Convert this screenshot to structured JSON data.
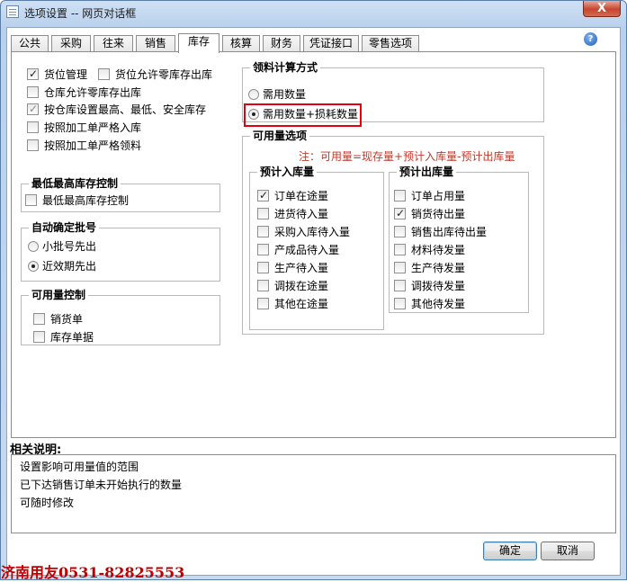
{
  "window": {
    "title": "选项设置 -- 网页对话框",
    "close_label": "X"
  },
  "tabs": [
    "公共",
    "采购",
    "往来",
    "销售",
    "库存",
    "核算",
    "财务",
    "凭证接口",
    "零售选项"
  ],
  "left_options": [
    {
      "label": "货位管理",
      "checked": true
    },
    {
      "label": "货位允许零库存出库",
      "checked": false
    },
    {
      "label": "仓库允许零库存出库",
      "checked": false
    },
    {
      "label": "按仓库设置最高、最低、安全库存",
      "checked": true
    },
    {
      "label": "按照加工单严格入库",
      "checked": false
    },
    {
      "label": "按照加工单严格领料",
      "checked": false
    }
  ],
  "min_max": {
    "title": "最低最高库存控制",
    "option": "最低最高库存控制"
  },
  "batch": {
    "title": "自动确定批号",
    "options": [
      "小批号先出",
      "近效期先出"
    ],
    "selected": 1
  },
  "avail_ctrl": {
    "title": "可用量控制",
    "options": [
      "销货单",
      "库存单据"
    ]
  },
  "material_calc": {
    "title": "领料计算方式",
    "options": [
      "需用数量",
      "需用数量+损耗数量"
    ],
    "selected": 1
  },
  "avail_opts": {
    "title": "可用量选项",
    "note": "注：可用量=现存量+预计入库量-预计出库量",
    "in": {
      "title": "预计入库量",
      "items": [
        {
          "label": "订单在途量",
          "checked": true
        },
        {
          "label": "进货待入量",
          "checked": false
        },
        {
          "label": "采购入库待入量",
          "checked": false
        },
        {
          "label": "产成品待入量",
          "checked": false
        },
        {
          "label": "生产待入量",
          "checked": false
        },
        {
          "label": "调拨在途量",
          "checked": false
        },
        {
          "label": "其他在途量",
          "checked": false
        }
      ]
    },
    "out": {
      "title": "预计出库量",
      "items": [
        {
          "label": "订单占用量",
          "checked": false
        },
        {
          "label": "销货待出量",
          "checked": true
        },
        {
          "label": "销售出库待出量",
          "checked": false
        },
        {
          "label": "材料待发量",
          "checked": false
        },
        {
          "label": "生产待发量",
          "checked": false
        },
        {
          "label": "调拨待发量",
          "checked": false
        },
        {
          "label": "其他待发量",
          "checked": false
        }
      ]
    }
  },
  "desc": {
    "label": "相关说明:",
    "lines": [
      "设置影响可用量值的范围",
      "已下达销售订单未开始执行的数量",
      "可随时修改"
    ]
  },
  "buttons": {
    "ok": "确定",
    "cancel": "取消"
  },
  "watermark": "济南用友0531-82825553"
}
